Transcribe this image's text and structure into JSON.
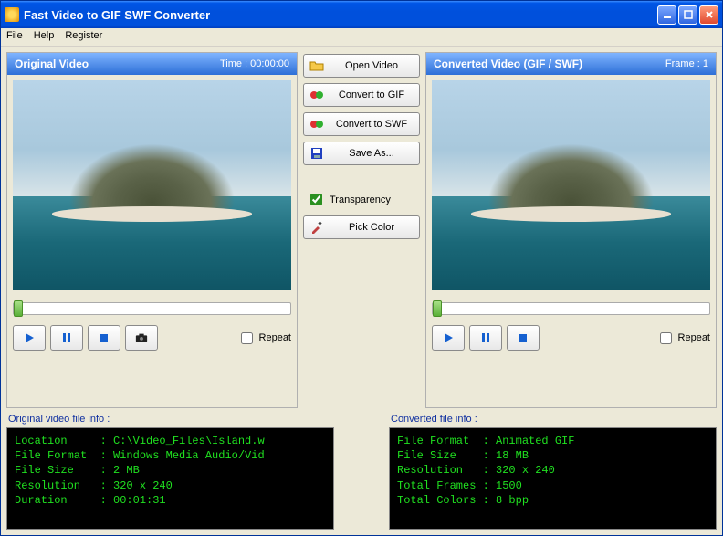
{
  "title": "Fast Video to GIF SWF Converter",
  "menu": {
    "file": "File",
    "help": "Help",
    "register": "Register"
  },
  "panels": {
    "left": {
      "title": "Original Video",
      "rightPrefix": "Time : ",
      "rightValue": "00:00:00",
      "repeat": "Repeat"
    },
    "right": {
      "title": "Converted Video (GIF / SWF)",
      "rightPrefix": "Frame : ",
      "rightValue": "1",
      "repeat": "Repeat"
    }
  },
  "actions": {
    "open": "Open Video",
    "toGif": "Convert to GIF",
    "toSwf": "Convert to SWF",
    "saveAs": "Save As...",
    "transparency": "Transparency",
    "pickColor": "Pick Color"
  },
  "info": {
    "leftLabel": "Original video file info :",
    "rightLabel": "Converted file info :",
    "leftText": "Location     : C:\\Video_Files\\Island.w\nFile Format  : Windows Media Audio/Vid\nFile Size    : 2 MB\nResolution   : 320 x 240\nDuration     : 00:01:31",
    "rightText": "File Format  : Animated GIF\nFile Size    : 18 MB\nResolution   : 320 x 240\nTotal Frames : 1500\nTotal Colors : 8 bpp"
  }
}
